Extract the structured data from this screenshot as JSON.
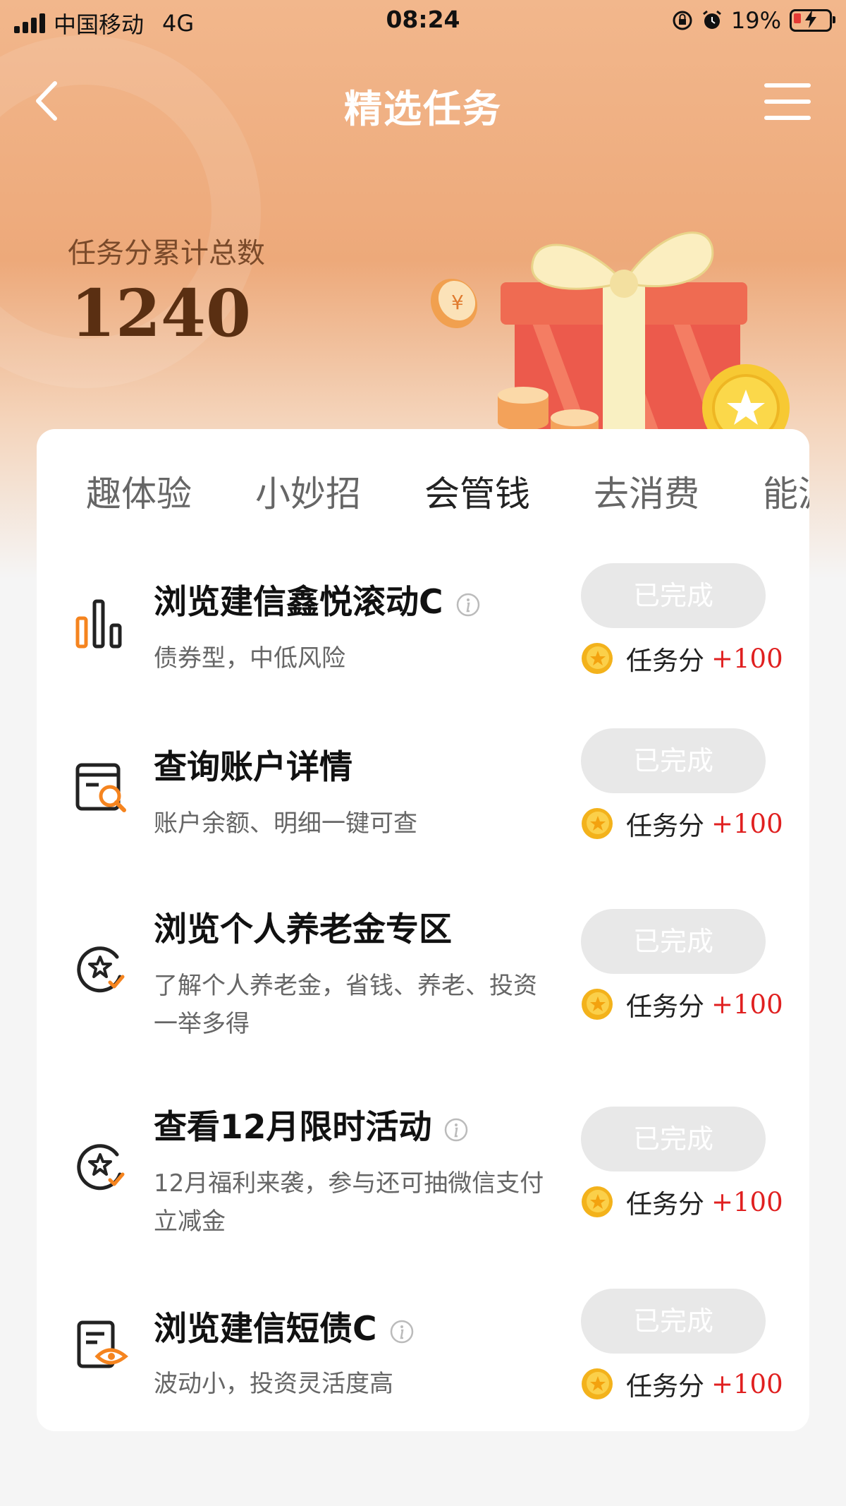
{
  "status_bar": {
    "carrier": "中国移动",
    "network": "4G",
    "time": "08:24",
    "battery": "19%"
  },
  "nav": {
    "title": "精选任务"
  },
  "score": {
    "label": "任务分累计总数",
    "value": "1240"
  },
  "tabs": [
    {
      "label": "趣体验"
    },
    {
      "label": "小妙招"
    },
    {
      "label": "会管钱",
      "active": true
    },
    {
      "label": "去消费"
    },
    {
      "label": "能源"
    }
  ],
  "tasks": [
    {
      "icon": "bar-chart-icon",
      "title": "浏览建信鑫悦滚动C",
      "has_info": true,
      "desc": "债券型，中低风险",
      "button": "已完成",
      "reward_label": "任务分",
      "reward_value": "+100"
    },
    {
      "icon": "account-search-icon",
      "title": "查询账户详情",
      "has_info": false,
      "desc": "账户余额、明细一键可查",
      "button": "已完成",
      "reward_label": "任务分",
      "reward_value": "+100"
    },
    {
      "icon": "star-check-icon",
      "title": "浏览个人养老金专区",
      "has_info": false,
      "desc": "了解个人养老金，省钱、养老、投资一举多得",
      "button": "已完成",
      "reward_label": "任务分",
      "reward_value": "+100"
    },
    {
      "icon": "star-check-icon",
      "title": "查看12月限时活动",
      "has_info": true,
      "desc": "12月福利来袭，参与还可抽微信支付立减金",
      "button": "已完成",
      "reward_label": "任务分",
      "reward_value": "+100"
    },
    {
      "icon": "document-eye-icon",
      "title": "浏览建信短债C",
      "has_info": true,
      "desc": "波动小，投资灵活度高",
      "button": "已完成",
      "reward_label": "任务分",
      "reward_value": "+100"
    }
  ],
  "colors": {
    "accent": "#f5841f",
    "reward": "#e02020",
    "hero": "#eda97a"
  }
}
